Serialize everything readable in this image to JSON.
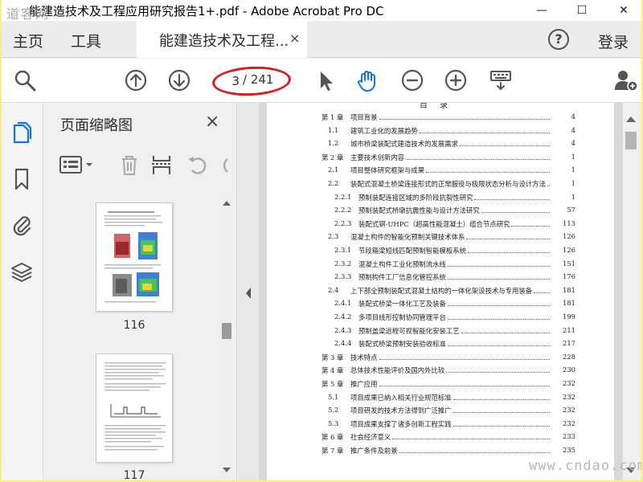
{
  "window": {
    "title": "能建造技术及工程应用研究报告1+.pdf - Adobe Acrobat Pro DC",
    "watermark": "道客网",
    "minimize": "—",
    "maximize": "☐",
    "close": "✕"
  },
  "tabs": {
    "home": "主页",
    "tools": "工具",
    "document": "能建造技术及工程...",
    "close": "×",
    "help": "?",
    "login": "登录"
  },
  "toolbar": {
    "current_page": "3",
    "total_pages": "/ 241",
    "icons": [
      "search-icon",
      "page-up-icon",
      "page-down-icon",
      "select-arrow-icon",
      "hand-icon",
      "zoom-out-icon",
      "zoom-in-icon",
      "keyboard-icon",
      "add-user-icon"
    ]
  },
  "left_rail": {
    "icons": [
      "page-thumbnails-icon",
      "bookmark-icon",
      "attachment-icon",
      "layers-icon"
    ]
  },
  "thumbnail_panel": {
    "title": "页面缩略图",
    "close": "×",
    "thumbnails": [
      {
        "page": "116"
      },
      {
        "page": "117"
      }
    ]
  },
  "toc": {
    "heading": "目 录",
    "rows": [
      {
        "level": 0,
        "num": "第 1 章",
        "title": "项目背景",
        "page": "4"
      },
      {
        "level": 1,
        "num": "1.1",
        "title": "建筑工业化的发展趋势",
        "page": "4"
      },
      {
        "level": 1,
        "num": "1.2",
        "title": "城市桥梁装配式建造技术的发展需求",
        "page": "4"
      },
      {
        "level": 0,
        "num": "第 2 章",
        "title": "主要技术创新内容",
        "page": "1"
      },
      {
        "level": 1,
        "num": "2.1",
        "title": "项目整体研究框架与成果",
        "page": "1"
      },
      {
        "level": 1,
        "num": "2.2",
        "title": "装配式混凝土桥梁连接形式的正常服役与极限状态分析与设计方法",
        "page": "1"
      },
      {
        "level": 2,
        "num": "2.2.1",
        "title": "预制装配连接区域的多阶段抗裂性研究",
        "page": "1"
      },
      {
        "level": 2,
        "num": "2.2.2",
        "title": "预制装配式桥墩抗震性能与设计方法研究",
        "page": "57"
      },
      {
        "level": 2,
        "num": "2.2.3",
        "title": "装配式钢-UHPC（超高性能混凝土）组合节点研究",
        "page": "113"
      },
      {
        "level": 1,
        "num": "2.3",
        "title": "混凝土构件的智能化预制关键技术体系",
        "page": "126"
      },
      {
        "level": 2,
        "num": "2.3.1",
        "title": "节段箱梁短线匹配预制智能模板系统",
        "page": "126"
      },
      {
        "level": 2,
        "num": "2.3.2",
        "title": "混凝土构件工业化预制流水线",
        "page": "151"
      },
      {
        "level": 2,
        "num": "2.3.3",
        "title": "预制构件工厂信息化管控系统",
        "page": "176"
      },
      {
        "level": 1,
        "num": "2.4",
        "title": "上下部全预制装配式混凝土结构的一体化架设技术与专用装备",
        "page": "181"
      },
      {
        "level": 2,
        "num": "2.4.1",
        "title": "装配式桥梁一体化工艺及装备",
        "page": "181"
      },
      {
        "level": 2,
        "num": "2.4.2",
        "title": "多项目线形控制协同管理平台",
        "page": "199"
      },
      {
        "level": 2,
        "num": "2.4.3",
        "title": "预制盖梁远程可视智能化安装工艺",
        "page": "211"
      },
      {
        "level": 2,
        "num": "2.4.4",
        "title": "装配式桥梁预制安装验收标准",
        "page": "217"
      },
      {
        "level": 0,
        "num": "第 3 章",
        "title": "技术特点",
        "page": "228"
      },
      {
        "level": 0,
        "num": "第 4 章",
        "title": "总体技术性能评价及国内外比较",
        "page": "230"
      },
      {
        "level": 0,
        "num": "第 5 章",
        "title": "推广应用",
        "page": "232"
      },
      {
        "level": 1,
        "num": "5.1",
        "title": "项目成果已纳入相关行业规范标准",
        "page": "232"
      },
      {
        "level": 1,
        "num": "5.2",
        "title": "项目研发的技术方法得到广泛推广",
        "page": "232"
      },
      {
        "level": 1,
        "num": "5.3",
        "title": "项目成果支撑了诸多创新工程实践",
        "page": "232"
      },
      {
        "level": 0,
        "num": "第 6 章",
        "title": "社会经济意义",
        "page": "233"
      },
      {
        "level": 0,
        "num": "第 7 章",
        "title": "推广条件及前景",
        "page": "235"
      }
    ]
  },
  "footer_watermark": "www.cndao.com",
  "colors": {
    "accent_blue": "#1473e6",
    "annotation_red": "#d42020",
    "highlight_border": "#f5f07a"
  }
}
